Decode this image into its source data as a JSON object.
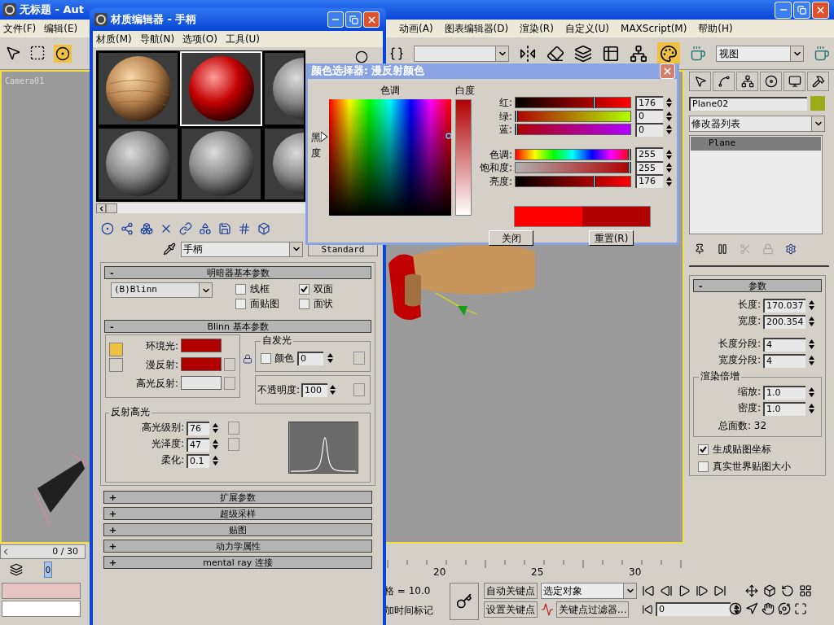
{
  "main_window": {
    "title": "无标题 - Aut",
    "menu": [
      "文件(F)",
      "编辑(E)",
      "动画(A)",
      "图表编辑器(D)",
      "渲染(R)",
      "自定义(U)",
      "MAXScript(M)",
      "帮助(H)"
    ],
    "view_dropdown": "视图"
  },
  "viewport": {
    "label": "Camera01"
  },
  "command_panel": {
    "object_name": "Plane02",
    "object_swatches": [
      {
        "color": "#9aad18"
      }
    ],
    "modifier_list": "修改器列表",
    "stack": [
      {
        "label": "Plane",
        "selected": true
      }
    ],
    "rollout": {
      "sign": "-",
      "title": "参数",
      "fields": [
        {
          "label": "长度:",
          "value": "170.037"
        },
        {
          "label": "宽度:",
          "value": "200.354"
        }
      ],
      "segments": [
        {
          "label": "长度分段:",
          "value": "4"
        },
        {
          "label": "宽度分段:",
          "value": "4"
        }
      ],
      "render_group": {
        "title": "渲染倍增",
        "fields": [
          {
            "label": "缩放:",
            "value": "1.0"
          },
          {
            "label": "密度:",
            "value": "1.0"
          }
        ],
        "total": "总面数: 32"
      },
      "checkboxes": [
        {
          "label": "生成贴图坐标",
          "checked": true
        },
        {
          "label": "真实世界贴图大小",
          "checked": false
        }
      ]
    }
  },
  "timeline": {
    "frame_counter": "0 / 30",
    "level": 0,
    "thumb": "0",
    "ruler_labels": [
      "20",
      "25",
      "30"
    ]
  },
  "status_bar": {
    "grid": "格 = 10.0",
    "time_tag": "加时间标记",
    "auto_key": "自动关键点",
    "set_key": "设置关键点",
    "key_mode": "选定对象",
    "key_filters": "关键点过滤器...",
    "frame": "0"
  },
  "material_editor": {
    "title": "材质编辑器 - 手柄",
    "menu": [
      "材质(M)",
      "导航(N)",
      "选项(O)",
      "工具(U)"
    ],
    "slots": [
      {
        "kind": "wood",
        "selected": false
      },
      {
        "kind": "red",
        "selected": true
      },
      {
        "kind": "gray",
        "selected": false
      },
      {
        "kind": "gray",
        "selected": false
      },
      {
        "kind": "gray",
        "selected": false
      },
      {
        "kind": "gray",
        "selected": false
      }
    ],
    "material_name": "手柄",
    "material_type": "Standard",
    "shader_rollout": {
      "sign": "-",
      "title": "明暗器基本参数",
      "shader": "(B)Blinn",
      "options": [
        {
          "label": "线框",
          "checked": false
        },
        {
          "label": "双面",
          "checked": true
        },
        {
          "label": "面贴图",
          "checked": false
        },
        {
          "label": "面状",
          "checked": false
        }
      ]
    },
    "basic_rollout": {
      "sign": "-",
      "title": "Blinn 基本参数",
      "colors": [
        {
          "label": "环境光:",
          "color": "#b00000"
        },
        {
          "label": "漫反射:",
          "color": "#b00000"
        },
        {
          "label": "高光反射:",
          "color": "#e6e6e6"
        }
      ],
      "self_illum": {
        "title": "自发光",
        "label": "颜色",
        "checked": false,
        "value": "0"
      },
      "opacity": {
        "label": "不透明度:",
        "value": "100"
      },
      "highlights": {
        "title": "反射高光",
        "fields": [
          {
            "label": "高光级别:",
            "value": "76"
          },
          {
            "label": "光泽度:",
            "value": "47"
          },
          {
            "label": "柔化:",
            "value": "0.1"
          }
        ]
      }
    },
    "collapsed_rollouts": [
      {
        "sign": "+",
        "title": "扩展参数"
      },
      {
        "sign": "+",
        "title": "超级采样"
      },
      {
        "sign": "+",
        "title": "贴图"
      },
      {
        "sign": "+",
        "title": "动力学属性"
      },
      {
        "sign": "+",
        "title": "mental ray 连接"
      }
    ]
  },
  "color_picker": {
    "title": "颜色选择器: 漫反射颜色",
    "hue_label": "色调",
    "whiteness_label": "白度",
    "blackness_label": "黑度",
    "channels": [
      {
        "kind": "red",
        "label": "红:",
        "value": "176",
        "level": 0.69
      },
      {
        "kind": "green",
        "label": "绿:",
        "value": "0",
        "level": 0
      },
      {
        "kind": "blue",
        "label": "蓝:",
        "value": "0",
        "level": 0
      },
      {
        "kind": "hue",
        "label": "色调:",
        "value": "255",
        "level": 1
      },
      {
        "kind": "saturation",
        "label": "饱和度:",
        "value": "255",
        "level": 1
      },
      {
        "kind": "value",
        "label": "亮度:",
        "value": "176",
        "level": 0.69
      }
    ],
    "swatches": [
      {
        "color": "#ff0000"
      },
      {
        "color": "#b00000"
      }
    ],
    "buttons": [
      "关闭",
      "重置(R)"
    ]
  }
}
